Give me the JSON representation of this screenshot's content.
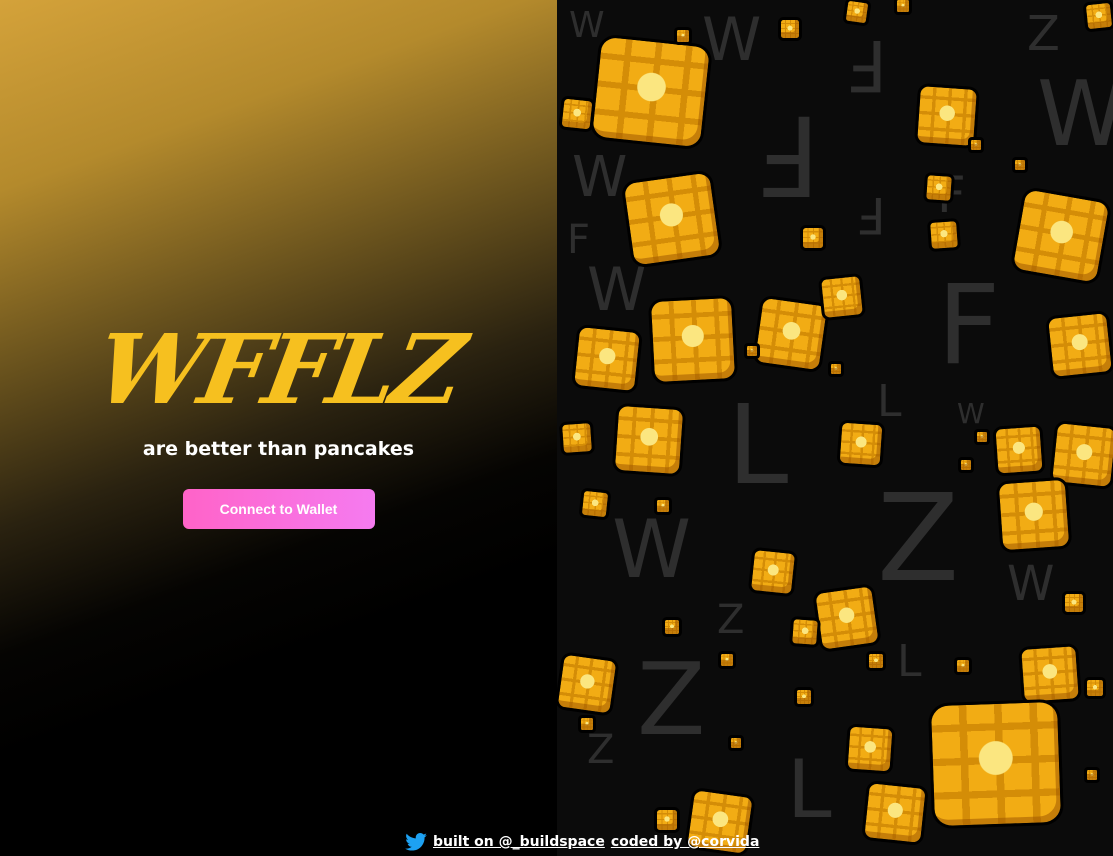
{
  "hero": {
    "logo_text": "WFFLZ",
    "tagline": "are better than pancakes",
    "connect_label": "Connect to Wallet"
  },
  "footer": {
    "icon": "twitter-icon",
    "built_on_text": "built on @_buildspace",
    "coded_by_text": "coded by @corvida"
  },
  "colors": {
    "logo": "#f6c01f",
    "button_start": "#ff63c8",
    "button_end": "#f57bf0",
    "waffle": "#f2ac14"
  }
}
